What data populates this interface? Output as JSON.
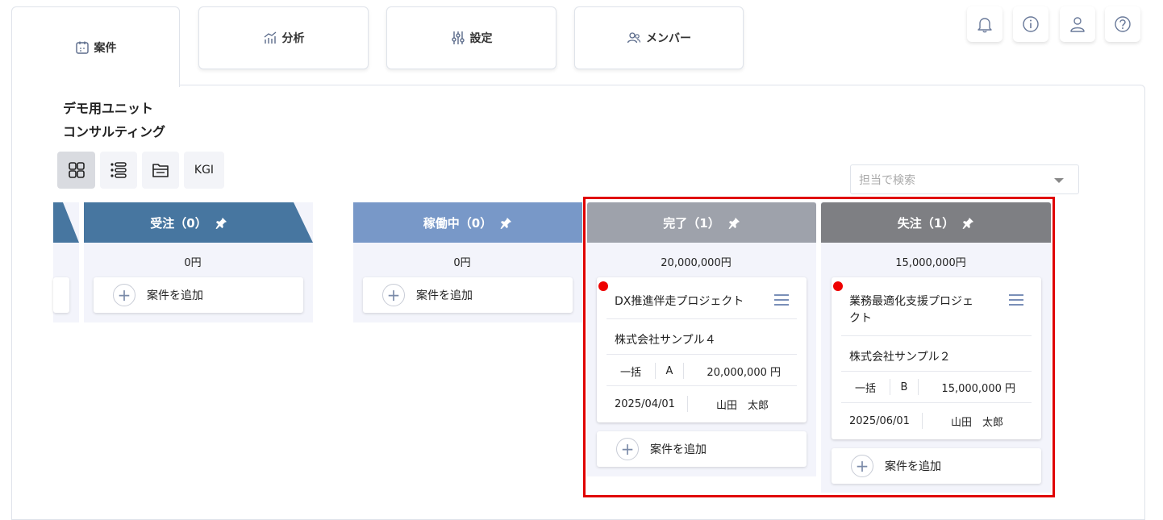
{
  "tabs": [
    {
      "label": "案件",
      "icon": "calendar-icon",
      "active": true
    },
    {
      "label": "分析",
      "icon": "chart-icon",
      "active": false
    },
    {
      "label": "設定",
      "icon": "sliders-icon",
      "active": false
    },
    {
      "label": "メンバー",
      "icon": "members-icon",
      "active": false
    }
  ],
  "top_icons": [
    "bell-icon",
    "info-icon",
    "user-icon",
    "help-icon"
  ],
  "unit": {
    "line1": "デモ用ユニット",
    "line2": "コンサルティング"
  },
  "view_buttons": {
    "kgi_label": "KGI"
  },
  "search": {
    "placeholder": "担当で検索"
  },
  "columns": [
    {
      "title": "受注（0）",
      "amount": "0円",
      "color": "#4776a0",
      "add_label": "案件を追加"
    },
    {
      "title": "稼働中（0）",
      "amount": "0円",
      "color": "#7898c8",
      "add_label": "案件を追加"
    },
    {
      "title": "完了（1）",
      "amount": "20,000,000円",
      "color": "#9ea2ab",
      "add_label": "案件を追加",
      "card": {
        "title": "DX推進伴走プロジェクト",
        "client": "株式会社サンプル４",
        "contract": "一括",
        "rank": "A",
        "price": "20,000,000 円",
        "date": "2025/04/01",
        "owner": "山田　太郎"
      }
    },
    {
      "title": "失注（1）",
      "amount": "15,000,000円",
      "color": "#7e7f83",
      "add_label": "案件を追加",
      "card": {
        "title_l1": "業務最適化支援プロジェ",
        "title_l2": "クト",
        "client": "株式会社サンプル２",
        "contract": "一括",
        "rank": "B",
        "price": "15,000,000 円",
        "date": "2025/06/01",
        "owner": "山田　太郎"
      }
    }
  ],
  "colors": {
    "accent_red": "#ee0000",
    "highlight": "#e00000"
  }
}
